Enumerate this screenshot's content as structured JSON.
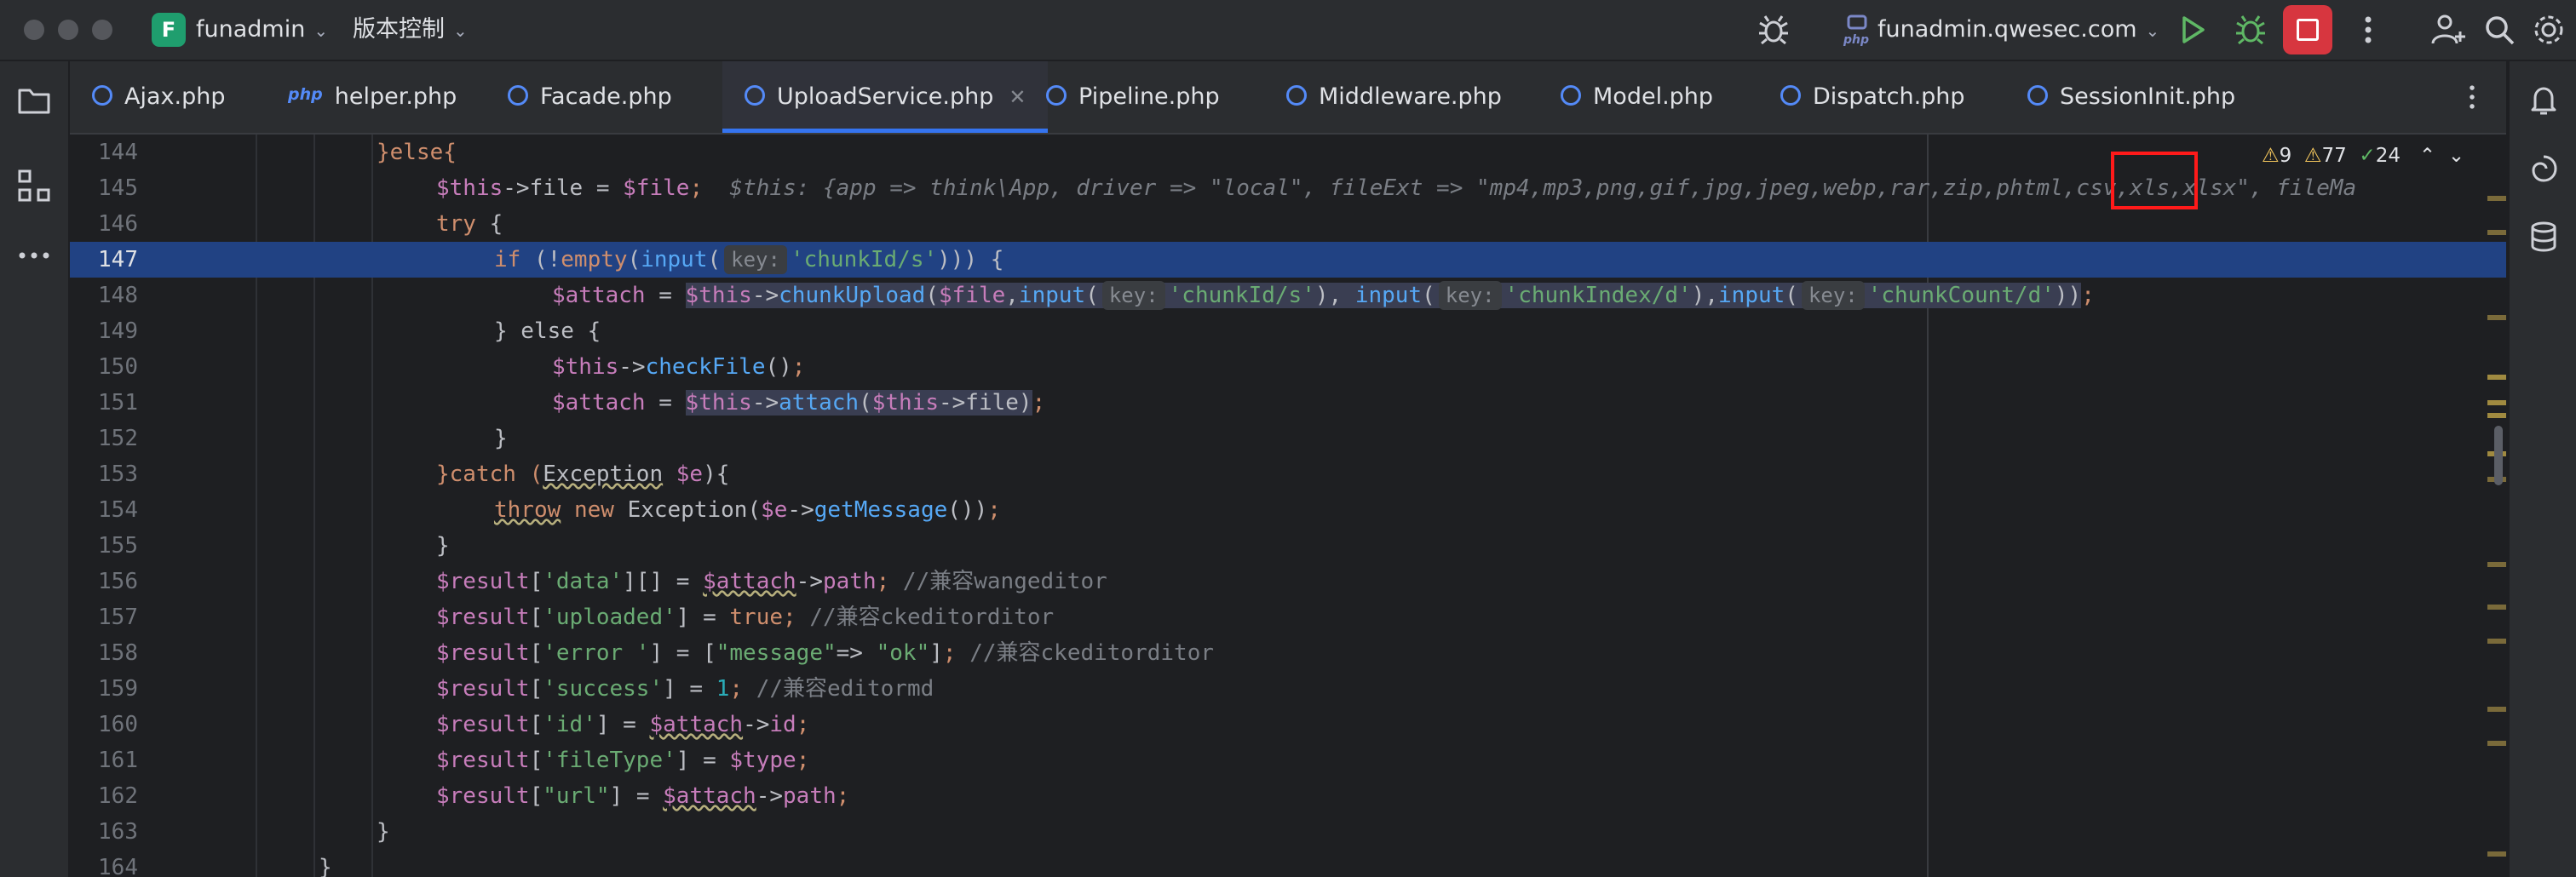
{
  "titlebar": {
    "project_initial": "F",
    "project_name": "funadmin",
    "vcs_label": "版本控制",
    "run_config": "funadmin.qwesec.com"
  },
  "icons": {
    "traffic_lights": [
      "close-dot",
      "minimize-dot",
      "zoom-dot"
    ],
    "toolbar": [
      "debug-bug-icon",
      "php-server-icon",
      "run-icon",
      "debug-icon",
      "stop-icon",
      "more-vert-icon",
      "add-user-icon",
      "search-icon",
      "settings-icon"
    ],
    "left_tools": [
      "folder-icon",
      "structure-icon",
      "more-horiz-icon"
    ],
    "right_tools": [
      "notifications-icon",
      "ai-assistant-icon",
      "database-icon"
    ]
  },
  "tabs": [
    {
      "label": "Ajax.php",
      "icon": "class-icon"
    },
    {
      "label": "helper.php",
      "icon": "php-icon"
    },
    {
      "label": "Facade.php",
      "icon": "class-icon"
    },
    {
      "label": "UploadService.php",
      "icon": "class-icon",
      "active": true
    },
    {
      "label": "Pipeline.php",
      "icon": "class-icon"
    },
    {
      "label": "Middleware.php",
      "icon": "class-icon"
    },
    {
      "label": "Model.php",
      "icon": "class-icon"
    },
    {
      "label": "Dispatch.php",
      "icon": "class-icon"
    },
    {
      "label": "SessionInit.php",
      "icon": "class-icon"
    }
  ],
  "inspections": {
    "warnings": "9",
    "weak_warnings": "77",
    "ok": "24"
  },
  "editor": {
    "current_line": "147",
    "lines": [
      {
        "n": "144"
      },
      {
        "n": "145"
      },
      {
        "n": "146"
      },
      {
        "n": "147"
      },
      {
        "n": "148"
      },
      {
        "n": "149"
      },
      {
        "n": "150"
      },
      {
        "n": "151"
      },
      {
        "n": "152"
      },
      {
        "n": "153"
      },
      {
        "n": "154"
      },
      {
        "n": "155"
      },
      {
        "n": "156"
      },
      {
        "n": "157"
      },
      {
        "n": "158"
      },
      {
        "n": "159"
      },
      {
        "n": "160"
      },
      {
        "n": "161"
      },
      {
        "n": "162"
      },
      {
        "n": "163"
      },
      {
        "n": "164"
      }
    ],
    "tokens": {
      "else_open": "}else{",
      "this_file": "$this",
      "arrow_file": "->file = ",
      "file_var": "$file",
      "semicolon": ";",
      "inline_debug": "$this: {app => think\\App, driver => \"local\", fileExt => \"mp4,mp3,png,gif,jpg,jpeg,webp,rar,zip,",
      "inline_highlight": "phtml",
      "inline_tail": ",csv,xls,xlsx\", fileMa",
      "try": "try",
      "brace_open": " {",
      "if": "if",
      "not_empty": " (!",
      "empty": "empty",
      "input": "input",
      "key_hint": "key:",
      "chunk_id": "'chunkId/s'",
      "if_close": "))) {",
      "attach": "$attach",
      "assign": " = ",
      "chunk_upload": "chunkUpload",
      "chunk_index": "'chunkIndex/d'",
      "chunk_count": "'chunkCount/d'",
      "else_block": "} else {",
      "check_file": "checkFile",
      "attach_fn": "attach",
      "brace_close": "}",
      "catch": "}catch (",
      "exception": "Exception",
      "e_var": "$e",
      "catch_close": "){",
      "throw": "throw",
      "new": "new",
      "get_message": "getMessage",
      "result": "$result",
      "data_key": "'data'",
      "path": "path",
      "cmt_wang": "//兼容wangeditor",
      "uploaded_key": "'uploaded'",
      "true": "true",
      "cmt_ck": "//兼容ckeditorditor",
      "error_key": "'error '",
      "message_key": "\"message\"",
      "ok": "\"ok\"",
      "success_key": "'success'",
      "one": "1",
      "cmt_md": "//兼容editormd",
      "id_key": "'id'",
      "id": "id",
      "filetype_key": "'fileType'",
      "type_var": "$type",
      "url_key": "\"url\""
    }
  }
}
